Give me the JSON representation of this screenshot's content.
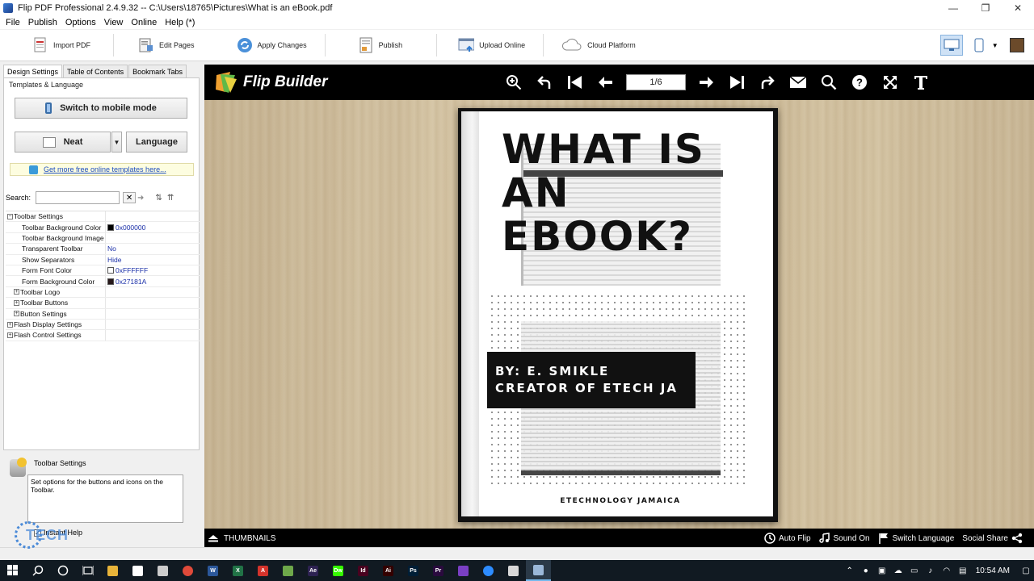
{
  "window": {
    "title": "Flip PDF Professional 2.4.9.32 -- C:\\Users\\18765\\Pictures\\What is an eBook.pdf",
    "minimize": "—",
    "restore": "❐",
    "close": "✕"
  },
  "menu": [
    "File",
    "Publish",
    "Options",
    "View",
    "Online",
    "Help (*)"
  ],
  "toolbar": {
    "import_pdf": "Import PDF",
    "edit_pages": "Edit Pages",
    "apply_changes": "Apply Changes",
    "publish": "Publish",
    "upload_online": "Upload Online",
    "cloud_platform": "Cloud Platform"
  },
  "left_panel": {
    "tabs": [
      "Design Settings",
      "Table of Contents",
      "Bookmark Tabs"
    ],
    "templates_group": "Templates & Language",
    "switch_mobile": "Switch to mobile mode",
    "template_name": "Neat",
    "language_button": "Language",
    "more_templates_link": "Get more free online templates here...",
    "search_label": "Search:",
    "search_value": "",
    "properties": [
      {
        "name": "Toolbar Settings",
        "value": "",
        "level": 0,
        "expander": "−"
      },
      {
        "name": "Toolbar Background Color",
        "value": "0x000000",
        "level": 1,
        "swatch": "#000000"
      },
      {
        "name": "Toolbar Background Image",
        "value": "",
        "level": 1
      },
      {
        "name": "Transparent Toolbar",
        "value": "No",
        "level": 1
      },
      {
        "name": "Show Separators",
        "value": "Hide",
        "level": 1
      },
      {
        "name": "Form Font Color",
        "value": "0xFFFFFF",
        "level": 1,
        "swatch": "#FFFFFF"
      },
      {
        "name": "Form Background Color",
        "value": "0x27181A",
        "level": 1,
        "swatch": "#27181A"
      },
      {
        "name": "Toolbar Logo",
        "value": "",
        "level": 1,
        "expander": "+"
      },
      {
        "name": "Toolbar Buttons",
        "value": "",
        "level": 1,
        "expander": "+"
      },
      {
        "name": "Button Settings",
        "value": "",
        "level": 1,
        "expander": "+"
      },
      {
        "name": "Flash Display Settings",
        "value": "",
        "level": 0,
        "expander": "+"
      },
      {
        "name": "Flash Control Settings",
        "value": "",
        "level": 0,
        "expander": "+"
      }
    ],
    "help_title": "Toolbar Settings",
    "help_text": "Set options for the buttons and icons on the Toolbar.",
    "instant_help": "Instant Help"
  },
  "viewer": {
    "brand": "Flip Builder",
    "page_indicator": "1/6",
    "book": {
      "heading_lines": [
        "WHAT IS",
        "AN",
        "EBOOK?"
      ],
      "byline_lines": [
        "BY: E. SMIKLE",
        "CREATOR OF ETECH JA"
      ],
      "footer": "ETECHNOLOGY JAMAICA"
    },
    "bottom": {
      "thumbnails": "THUMBNAILS",
      "auto_flip": "Auto Flip",
      "sound_on": "Sound On",
      "switch_language": "Switch Language",
      "social_share": "Social Share"
    }
  },
  "watermark": "TECH",
  "taskbar": {
    "apps": [
      {
        "name": "file-explorer",
        "label": "",
        "color": "#e8b43a"
      },
      {
        "name": "store",
        "label": "",
        "color": "#ffffff"
      },
      {
        "name": "app-z",
        "label": "",
        "color": "#cccccc"
      },
      {
        "name": "chrome",
        "label": "",
        "color": "#e04a3a"
      },
      {
        "name": "word",
        "label": "W",
        "color": "#2b579a"
      },
      {
        "name": "excel",
        "label": "X",
        "color": "#217346"
      },
      {
        "name": "acrobat",
        "label": "A",
        "color": "#d4332b"
      },
      {
        "name": "app-green",
        "label": "",
        "color": "#6ea84a"
      },
      {
        "name": "after-effects",
        "label": "Ae",
        "color": "#2d2252"
      },
      {
        "name": "dreamweaver",
        "label": "Dw",
        "color": "#35fa00"
      },
      {
        "name": "indesign",
        "label": "Id",
        "color": "#49021f"
      },
      {
        "name": "illustrator",
        "label": "Ai",
        "color": "#330000"
      },
      {
        "name": "photoshop",
        "label": "Ps",
        "color": "#001e36"
      },
      {
        "name": "premiere",
        "label": "Pr",
        "color": "#2a0a3e"
      },
      {
        "name": "app-purple",
        "label": "",
        "color": "#7a3fc4"
      },
      {
        "name": "zoom",
        "label": "",
        "color": "#2d8cff"
      },
      {
        "name": "flip-pdf-1",
        "label": "",
        "color": "#d8d8d8"
      },
      {
        "name": "flip-pdf-2",
        "label": "",
        "color": "#9bb8d8"
      }
    ],
    "clock": "10:54 AM"
  }
}
